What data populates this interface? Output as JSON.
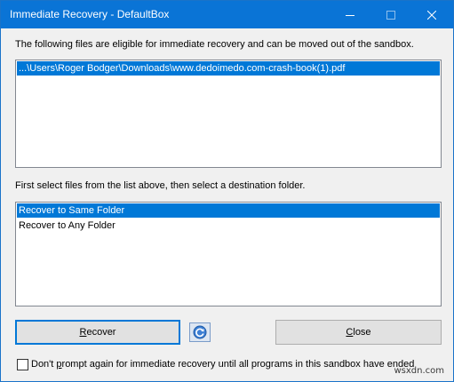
{
  "window": {
    "title": "Immediate Recovery - DefaultBox"
  },
  "titlebar_icons": {
    "minimize": "minimize-icon",
    "maximize": "maximize-icon",
    "close": "close-icon"
  },
  "files_section": {
    "label": "The following files are eligible for immediate recovery and can be moved out of the sandbox.",
    "items": [
      {
        "text": "...\\Users\\Roger Bodger\\Downloads\\www.dedoimedo.com-crash-book(1).pdf",
        "selected": true
      }
    ]
  },
  "destination_section": {
    "label": "First select files from the list above, then select a destination folder.",
    "items": [
      {
        "text": "Recover to Same Folder",
        "selected": true
      },
      {
        "text": "Recover to Any Folder",
        "selected": false
      }
    ]
  },
  "buttons": {
    "recover_first": "R",
    "recover_rest": "ecover",
    "close_first": "C",
    "close_rest": "lose",
    "refresh_icon": "refresh-icon"
  },
  "footer": {
    "checkbox_checked": false,
    "checkbox_label_prefix": "Don't ",
    "checkbox_label_accel": "p",
    "checkbox_label_rest": "rompt again for immediate recovery until all programs in this sandbox have ended",
    "watermark": "wsxdn.com"
  },
  "colors": {
    "titlebar": "#0a74d6",
    "selection": "#0078d7",
    "window_bg": "#f0f0f0"
  }
}
